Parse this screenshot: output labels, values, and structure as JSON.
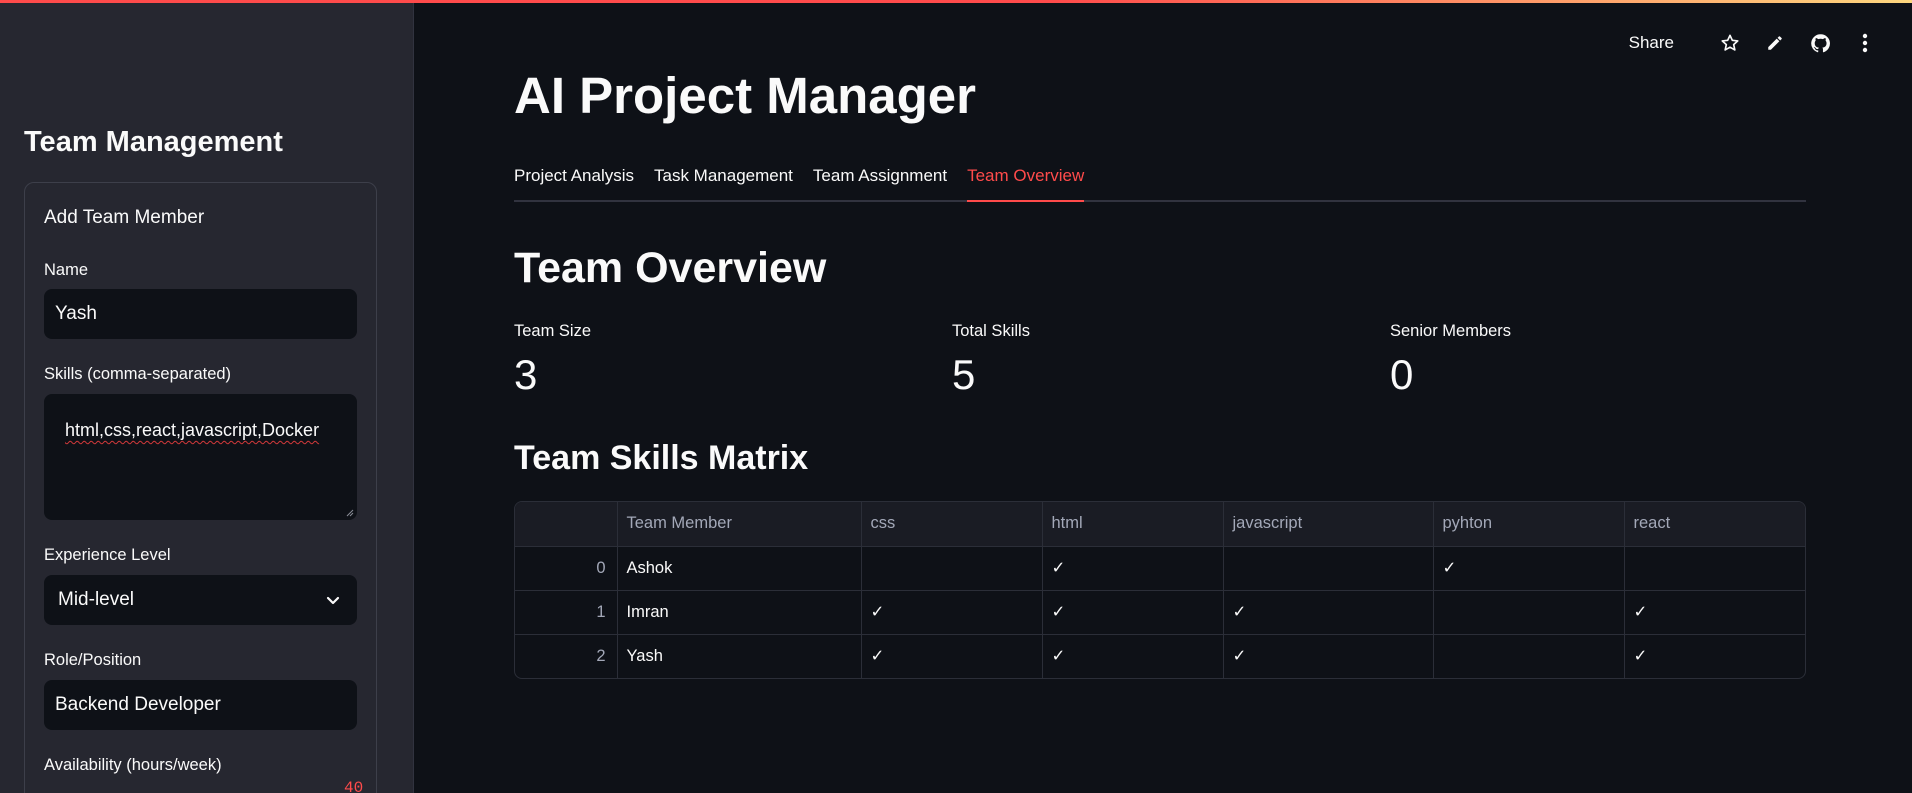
{
  "sidebar": {
    "title": "Team Management",
    "form": {
      "title": "Add Team Member",
      "name_label": "Name",
      "name_value": "Yash",
      "skills_label": "Skills (comma-separated)",
      "skills_value": "html,css,react,javascript,Docker",
      "experience_label": "Experience Level",
      "experience_value": "Mid-level",
      "role_label": "Role/Position",
      "role_value": "Backend Developer",
      "availability_label": "Availability (hours/week)",
      "availability_value": "40"
    }
  },
  "toolbar": {
    "share_label": "Share"
  },
  "main": {
    "title": "AI Project Manager",
    "tabs": [
      {
        "label": "Project Analysis"
      },
      {
        "label": "Task Management"
      },
      {
        "label": "Team Assignment"
      },
      {
        "label": "Team Overview"
      }
    ],
    "active_tab": "Team Overview",
    "section_title": "Team Overview",
    "metrics": [
      {
        "label": "Team Size",
        "value": "3"
      },
      {
        "label": "Total Skills",
        "value": "5"
      },
      {
        "label": "Senior Members",
        "value": "0"
      }
    ],
    "matrix_title": "Team Skills Matrix",
    "table": {
      "columns": [
        "",
        "Team Member",
        "css",
        "html",
        "javascript",
        "pyhton",
        "react"
      ],
      "rows": [
        [
          "0",
          "Ashok",
          "",
          "✓",
          "",
          "✓",
          ""
        ],
        [
          "1",
          "Imran",
          "✓",
          "✓",
          "✓",
          "",
          "✓"
        ],
        [
          "2",
          "Yash",
          "✓",
          "✓",
          "✓",
          "",
          "✓"
        ]
      ]
    }
  },
  "colors": {
    "accent": "#ff4b4b",
    "background": "#0e1117",
    "sidebar": "#262730"
  }
}
